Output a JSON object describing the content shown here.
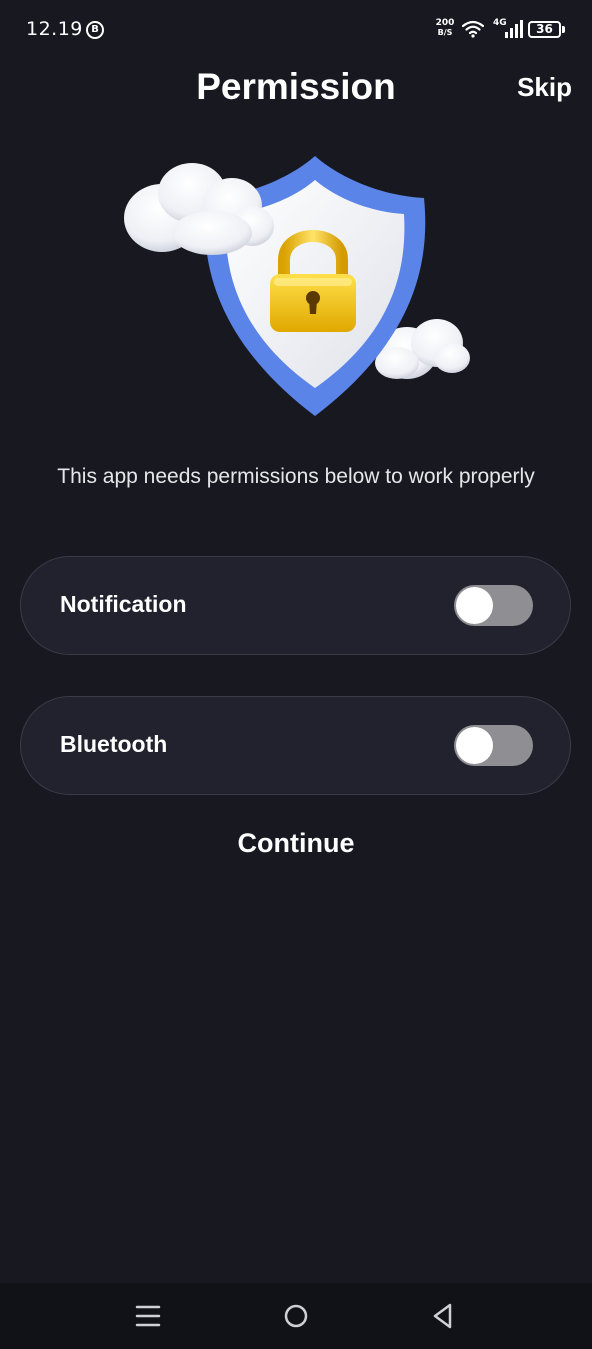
{
  "status_bar": {
    "time": "12.19",
    "notification_badge": "B",
    "speed_value": "200",
    "speed_unit": "B/S",
    "network_type": "4G",
    "battery_level": "36",
    "icons": [
      "b-circle-icon",
      "wifi-icon",
      "signal-icon",
      "battery-icon"
    ]
  },
  "header": {
    "title": "Permission",
    "skip_label": "Skip"
  },
  "illustration": {
    "icon": "shield-lock-illustration",
    "shield_color": "#5b84e8",
    "lock_color": "#f2c21a"
  },
  "description": "This app needs permissions below to work properly",
  "permissions": [
    {
      "label": "Notification",
      "enabled": false
    },
    {
      "label": "Bluetooth",
      "enabled": false
    }
  ],
  "continue_label": "Continue",
  "nav_bar": {
    "icons": [
      "menu-icon",
      "home-icon",
      "back-icon"
    ]
  },
  "colors": {
    "background": "#181920",
    "card": "#21222d",
    "toggle_off": "#8e8e93"
  }
}
